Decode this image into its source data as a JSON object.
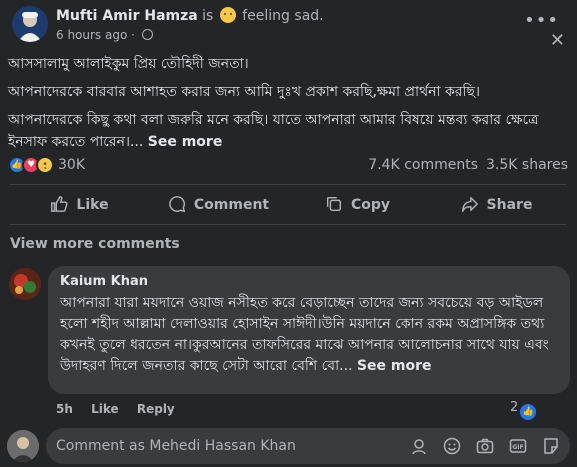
{
  "post": {
    "author": "Mufti Amir Hamza",
    "is_text": "is",
    "feeling": "feeling sad.",
    "time": "6 hours ago",
    "paragraph1": "আসসালামু আলাইকুম প্রিয় তৌহিদী জনতা।",
    "paragraph2": "আপনাদেরকে বারবার আশাহত করার জন্য আমি দুঃখ প্রকাশ করছি,ক্ষমা প্রার্থনা করছি।",
    "paragraph3": "আপনাদেরকে কিছু কথা বলা জরুরি মনে করছি। যাতে আপনারা আমার বিষয়ে মন্তব্য করার ক্ষেত্রে ইনসাফ করতে পারেন।...",
    "see_more": "See more"
  },
  "stats": {
    "reactions": "30K",
    "comments": "7.4K comments",
    "shares": "3.5K shares"
  },
  "actions": {
    "like": "Like",
    "comment": "Comment",
    "copy": "Copy",
    "share": "Share"
  },
  "view_more_comments": "View more comments",
  "comment": {
    "author": "Kaium Khan",
    "text": "আপনারা যারা ময়দানে ওয়াজ নসীহত করে বেড়াচ্ছেন তাদের জন্য সবচেয়ে বড় আইডল হলো শহীদ আল্লামা দেলাওয়ার হোসাইন সাঈদী।উনি ময়দানে কোন রকম অপ্রাসঙ্গিক তথ্য কখনই তুলে ধরতেন না।কুরআনের তাফসিরের মাঝে আপনার আলোচনার সাথে যায় এবং উদাহরণ দিলে জনতার কাছে সেটা আরো বেশি বো...",
    "see_more": "See more",
    "time": "5h",
    "like": "Like",
    "reply": "Reply",
    "reaction_count": "2"
  },
  "composer": {
    "placeholder": "Comment as Mehedi Hassan Khan"
  },
  "colors": {
    "background": "#242526",
    "bubble": "#3a3b3c",
    "text_primary": "#e4e6eb",
    "text_secondary": "#b0b3b8",
    "like_blue": "#2078f4"
  },
  "icons": [
    "more-icon",
    "close-icon",
    "globe-icon",
    "like-icon",
    "comment-icon",
    "copy-icon",
    "share-icon",
    "sticker-icon",
    "emoji-icon",
    "camera-icon",
    "gif-icon",
    "avatar-sticker-icon"
  ]
}
